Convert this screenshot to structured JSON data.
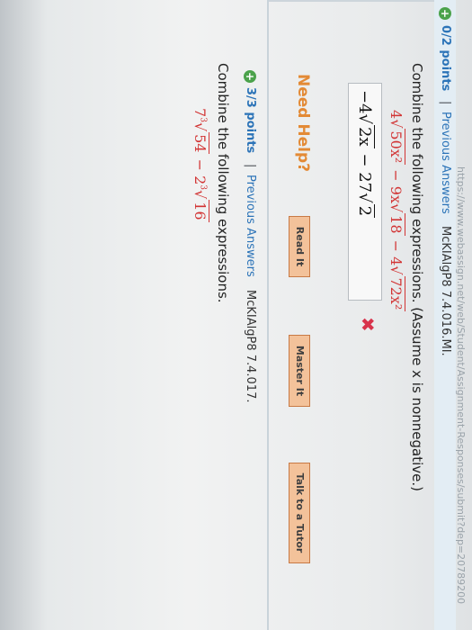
{
  "browser": {
    "url": "https://www.webassign.net/web/Student/Assignment-Responses/submit?dep=20789200"
  },
  "question1": {
    "points": "0/2 points",
    "separator": "|",
    "previous_answers": "Previous Answers",
    "code": "McKIAlgP8 7.4.016.MI.",
    "prompt": "Combine the following expressions. (Assume x is nonnegative.)",
    "expression": {
      "c1": "4",
      "r1": "50x²",
      "op1": " − ",
      "c2": "9x",
      "r2": "18",
      "op2": " − ",
      "c3": "4",
      "r3": "72x²"
    },
    "answer": {
      "c1": "−4",
      "r1": "2x",
      "op": " − ",
      "c2": "27",
      "r2": "2"
    },
    "result_icon": "x-mark",
    "need_help": "Need Help?",
    "buttons": [
      "Read It",
      "Master It",
      "Talk to a Tutor"
    ]
  },
  "question2": {
    "points": "3/3 points",
    "separator": "|",
    "previous_answers": "Previous Answers",
    "code": "McKIAlgP8 7.4.017.",
    "prompt": "Combine the following expressions.",
    "expression": {
      "c1": "7",
      "r1": "54",
      "op": " − ",
      "c2": "2",
      "r2": "16",
      "index": "3"
    }
  },
  "colors": {
    "link": "#2c74b8",
    "incorrect": "#d8334b",
    "help": "#e38a35",
    "button": "#f3c29a",
    "points_icon": "#4ba24b"
  }
}
